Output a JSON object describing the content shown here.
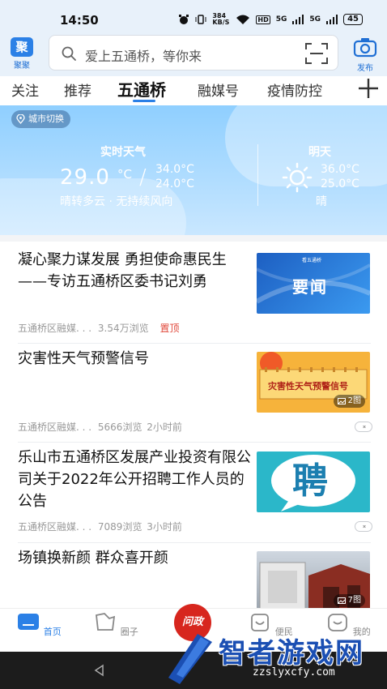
{
  "status_bar": {
    "time": "14:50",
    "network_speed": "384 KB/S",
    "hd": "HD",
    "signal1": "5G",
    "signal2": "5G",
    "battery": "45"
  },
  "header": {
    "left_button_label": "聚聚",
    "left_logo_glyph": "聚",
    "search_placeholder": "爱上五通桥，等你来",
    "right_button_label": "发布"
  },
  "tabs": [
    {
      "label": "关注",
      "active": false
    },
    {
      "label": "推荐",
      "active": false
    },
    {
      "label": "五通桥",
      "active": true
    },
    {
      "label": "融媒号",
      "active": false
    },
    {
      "label": "疫情防控",
      "active": false
    }
  ],
  "weather": {
    "city_switch": "城市切换",
    "now_title": "实时天气",
    "now_temp": "29.0",
    "unit": "°C",
    "slash": "/",
    "now_high": "34.0°C",
    "now_low": "24.0°C",
    "now_desc": "晴转多云 · 无持续风向",
    "tomorrow_title": "明天",
    "tomorrow_high": "36.0°C",
    "tomorrow_low": "25.0°C",
    "tomorrow_desc": "晴"
  },
  "feed": [
    {
      "title": "凝心聚力谋发展 勇担使命惠民生 ——专访五通桥区委书记刘勇",
      "source": "五通桥区融媒. . .",
      "views": "3.54万浏览",
      "tag": "置顶",
      "thumb_text": "要闻",
      "thumb_small": "看五通桥"
    },
    {
      "title": "灾害性天气预警信号",
      "source": "五通桥区融媒. . .",
      "views": "5666浏览",
      "time": "2小时前",
      "thumb_text": "灾害性天气预警信号",
      "image_count": "2图"
    },
    {
      "title": "乐山市五通桥区发展产业投资有限公司关于2022年公开招聘工作人员的公告",
      "source": "五通桥区融媒. . .",
      "views": "7089浏览",
      "time": "3小时前",
      "thumb_text": "聘"
    },
    {
      "title": "场镇换新颜 群众喜开颜",
      "image_count": "7图"
    }
  ],
  "bottom_nav": [
    {
      "label": "首页",
      "active": true
    },
    {
      "label": "圈子",
      "active": false
    },
    {
      "label": "问政",
      "active": false
    },
    {
      "label": "便民",
      "active": false
    },
    {
      "label": "我的",
      "active": false
    }
  ],
  "watermark": {
    "title": "智者游戏网",
    "url": "zzslyxcfy.com"
  },
  "colors": {
    "accent": "#2b80e6",
    "pin": "#e0483b",
    "wenzheng": "#d7261e"
  }
}
